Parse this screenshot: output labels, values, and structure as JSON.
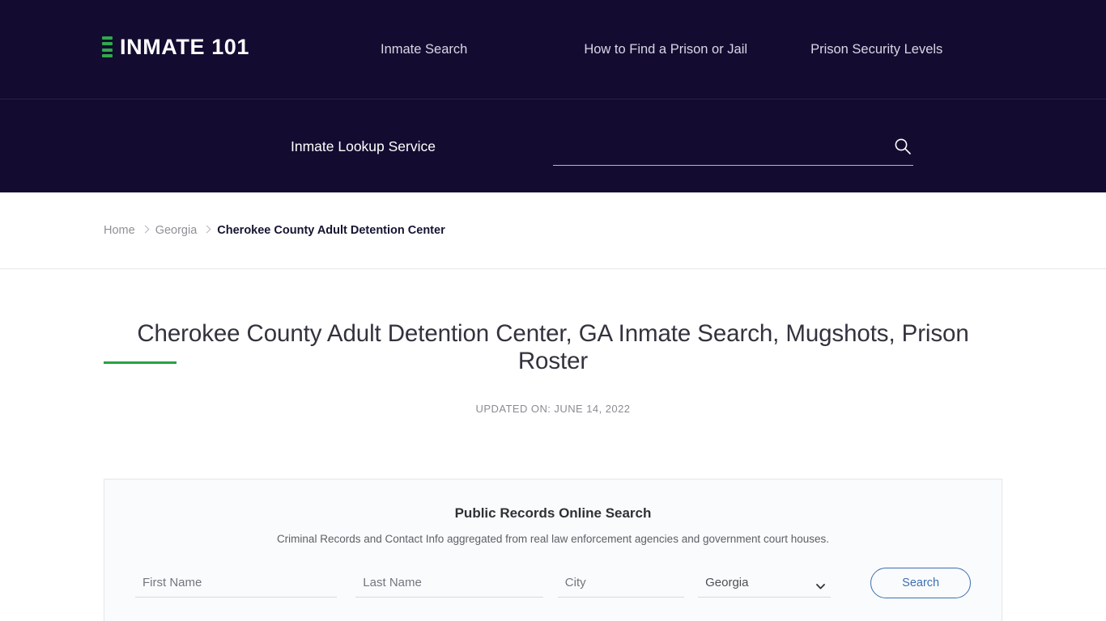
{
  "header": {
    "brand": "INMATE 101",
    "nav": [
      {
        "label": "Inmate Search"
      },
      {
        "label": "How to Find a Prison or Jail"
      },
      {
        "label": "Prison Security Levels"
      }
    ]
  },
  "lookup": {
    "label": "Inmate Lookup Service",
    "input_value": "",
    "input_placeholder": "",
    "icon": "search-icon"
  },
  "breadcrumb": {
    "items": [
      {
        "label": "Home"
      },
      {
        "label": "Georgia"
      },
      {
        "label": "Cherokee County Adult Detention Center"
      }
    ]
  },
  "page": {
    "title": "Cherokee County Adult Detention Center, GA Inmate Search, Mugshots, Prison Roster",
    "updated": "UPDATED ON: JUNE 14, 2022"
  },
  "form_card": {
    "title": "Public Records Online Search",
    "subtitle": "Criminal Records and Contact Info aggregated from real law enforcement agencies and government court houses.",
    "fields": {
      "first_name": {
        "value": "",
        "placeholder": "First Name"
      },
      "last_name": {
        "value": "",
        "placeholder": "Last Name"
      },
      "city": {
        "value": "",
        "placeholder": "City"
      },
      "state": {
        "selected": "Georgia",
        "icon": "chevron-down-icon"
      }
    },
    "submit_label": "Search"
  },
  "colors": {
    "header_bg": "#140c30",
    "accent_green": "#27a343",
    "button_blue": "#3c6fb5",
    "card_bg": "#fafbfc"
  }
}
